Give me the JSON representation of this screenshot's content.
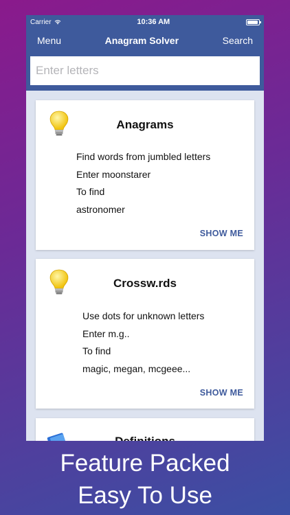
{
  "status": {
    "carrier": "Carrier",
    "time": "10:36 AM"
  },
  "nav": {
    "menu": "Menu",
    "title": "Anagram Solver",
    "search": "Search"
  },
  "search": {
    "placeholder": "Enter letters"
  },
  "cards": [
    {
      "title": "Anagrams",
      "lines": [
        "Find words from jumbled letters",
        "Enter moonstarer",
        "To find",
        "astronomer"
      ],
      "action": "SHOW ME",
      "icon": "lightbulb-icon"
    },
    {
      "title": "Crossw.rds",
      "lines": [
        "Use dots for unknown letters",
        "Enter m.g..",
        "To find",
        "magic, megan, mcgeee..."
      ],
      "action": "SHOW ME",
      "icon": "lightbulb-icon"
    },
    {
      "title": "Definitions",
      "icon": "book-icon"
    }
  ],
  "caption": {
    "line1": "Feature Packed",
    "line2": "Easy To Use"
  },
  "colors": {
    "brand": "#3e5a9c",
    "card_background": "#ffffff",
    "list_background": "#dde3f0"
  }
}
